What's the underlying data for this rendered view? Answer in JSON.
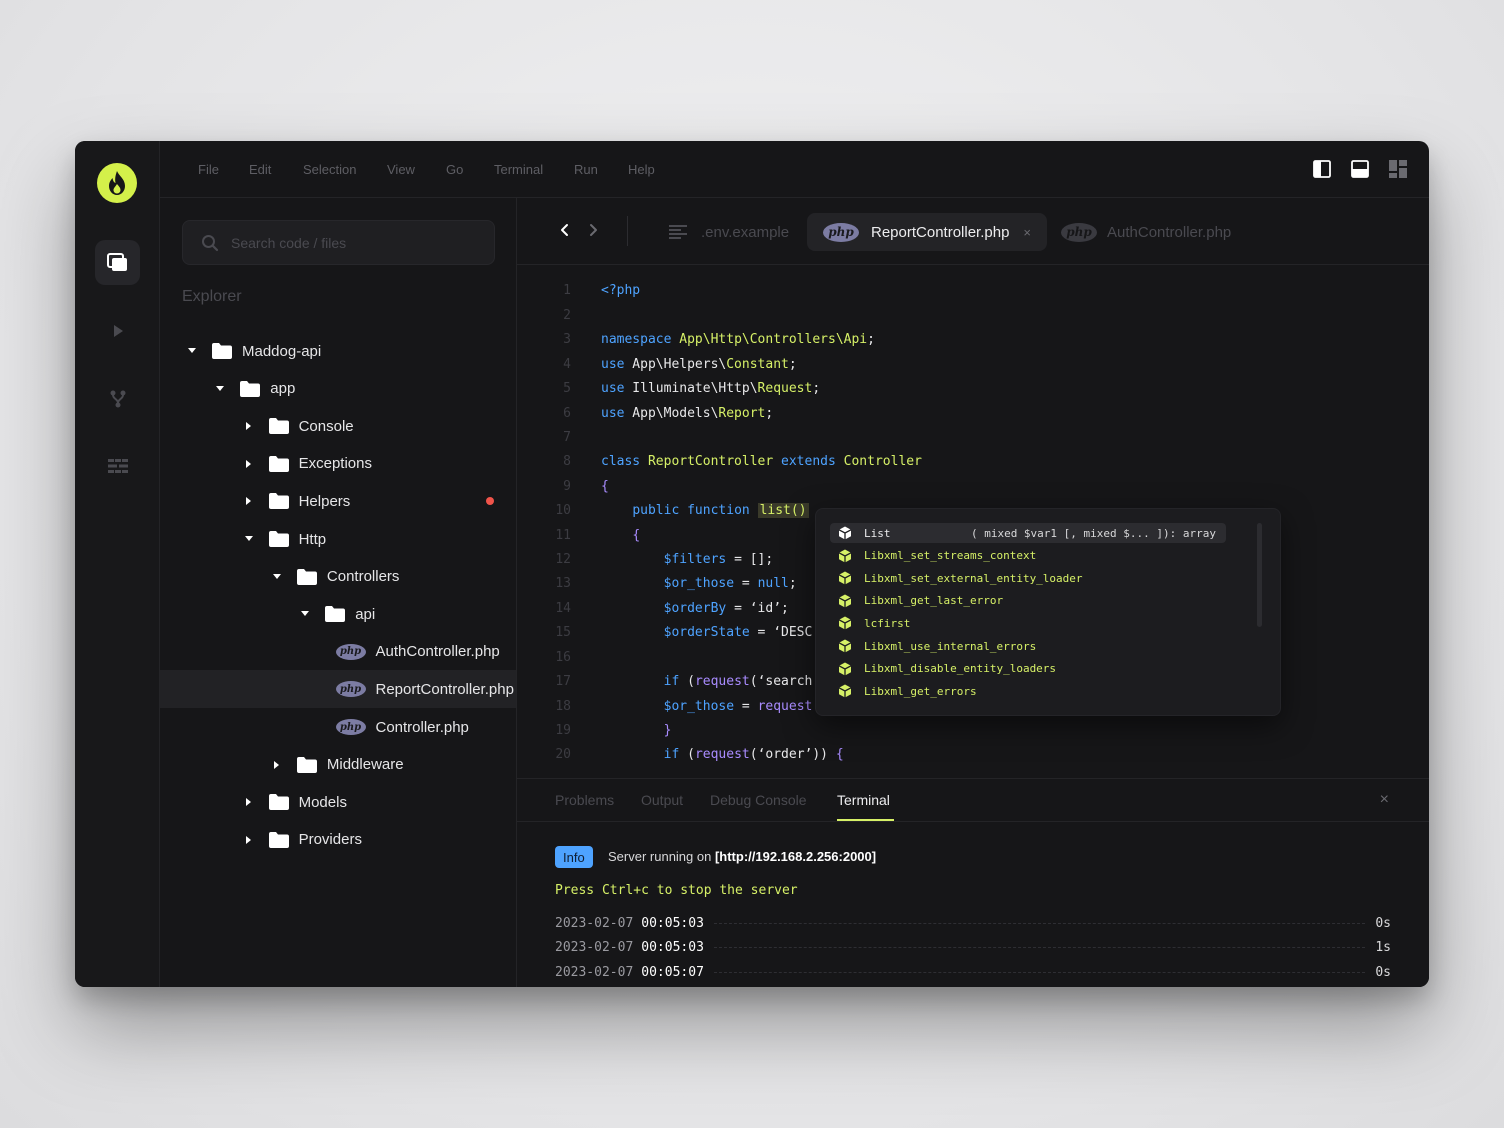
{
  "menu": [
    "File",
    "Edit",
    "Selection",
    "View",
    "Go",
    "Terminal",
    "Run",
    "Help"
  ],
  "search": {
    "placeholder": "Search code / files"
  },
  "explorer": {
    "title": "Explorer",
    "tree": [
      {
        "label": "Maddog-api",
        "type": "folder",
        "expanded": true
      },
      {
        "label": "app",
        "type": "folder",
        "expanded": true
      },
      {
        "label": "Console",
        "type": "folder",
        "expanded": false
      },
      {
        "label": "Exceptions",
        "type": "folder",
        "expanded": false
      },
      {
        "label": "Helpers",
        "type": "folder",
        "expanded": false,
        "modified": true
      },
      {
        "label": "Http",
        "type": "folder",
        "expanded": true
      },
      {
        "label": "Controllers",
        "type": "folder",
        "expanded": true
      },
      {
        "label": "api",
        "type": "folder",
        "expanded": true
      },
      {
        "label": "AuthController.php",
        "type": "php"
      },
      {
        "label": "ReportController.php",
        "type": "php",
        "selected": true
      },
      {
        "label": "Controller.php",
        "type": "php"
      },
      {
        "label": "Middleware",
        "type": "folder",
        "expanded": false
      },
      {
        "label": "Models",
        "type": "folder",
        "expanded": false
      },
      {
        "label": "Providers",
        "type": "folder",
        "expanded": false
      }
    ]
  },
  "tabs": [
    {
      "label": ".env.example",
      "icon": "text-file-icon",
      "active": false
    },
    {
      "label": "ReportController.php",
      "icon": "php",
      "active": true,
      "close": "×"
    },
    {
      "label": "AuthController.php",
      "icon": "php",
      "active": false
    }
  ],
  "php_badge": "php",
  "code_lines": [
    "1",
    "2",
    "3",
    "4",
    "5",
    "6",
    "7",
    "8",
    "9",
    "10",
    "11",
    "12",
    "13",
    "14",
    "15",
    "16",
    "17",
    "18",
    "19",
    "20"
  ],
  "autocomplete": {
    "items": [
      "List",
      "Libxml_set_streams_context",
      "Libxml_set_external_entity_loader",
      "Libxml_get_last_error",
      "lcfirst",
      "Libxml_use_internal_errors",
      "Libxml_disable_entity_loaders",
      "Libxml_get_errors"
    ],
    "signature": "( mixed $var1 [, mixed $... ]): array"
  },
  "panel": {
    "tabs": [
      "Problems",
      "Output",
      "Debug Console",
      "Terminal"
    ],
    "active_tab": "Terminal",
    "close": "×",
    "info_badge": "Info",
    "server_prefix": "Server running on ",
    "server_url": "[http://192.168.2.256:2000]",
    "press": "Press Ctrl+c to stop the server",
    "logs": [
      {
        "date": "2023-02-07",
        "time": "00:05:03",
        "duration": "0s"
      },
      {
        "date": "2023-02-07",
        "time": "00:05:03",
        "duration": "1s"
      },
      {
        "date": "2023-02-07",
        "time": "00:05:07",
        "duration": "0s"
      }
    ]
  },
  "colors": {
    "accent": "#d6f067",
    "keyword": "#4ea3ff",
    "php": "#7c7ca3",
    "info": "#4ea3ff",
    "modified": "#f0544a"
  }
}
